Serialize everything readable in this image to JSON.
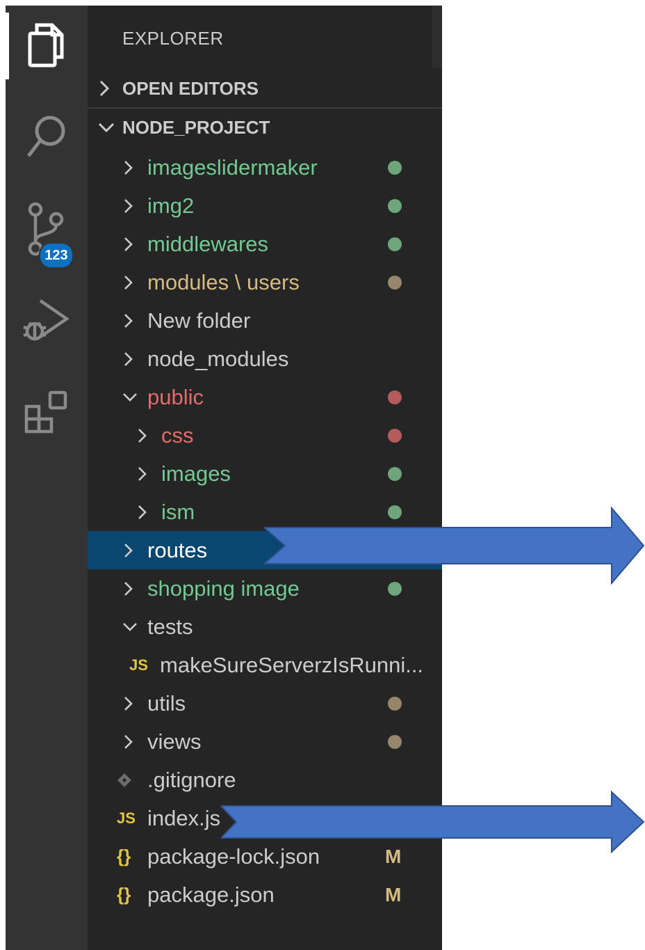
{
  "activity_bar": {
    "items": [
      {
        "icon": "files-icon",
        "active": true
      },
      {
        "icon": "search-icon",
        "active": false
      },
      {
        "icon": "source-control-icon",
        "active": false,
        "badge": "123"
      },
      {
        "icon": "run-debug-icon",
        "active": false
      },
      {
        "icon": "extensions-icon",
        "active": false
      }
    ]
  },
  "explorer": {
    "title": "EXPLORER",
    "open_editors": "OPEN EDITORS",
    "project": "NODE_PROJECT"
  },
  "tree": [
    {
      "label": "imageslidermaker",
      "kind": "folder",
      "expanded": false,
      "color": "#73c991",
      "status": "dot-green"
    },
    {
      "label": "img2",
      "kind": "folder",
      "expanded": false,
      "color": "#73c991",
      "status": "dot-green"
    },
    {
      "label": "middlewares",
      "kind": "folder",
      "expanded": false,
      "color": "#73c991",
      "status": "dot-green"
    },
    {
      "label": "modules \\ users",
      "kind": "folder",
      "expanded": false,
      "color": "#d7ba7d",
      "status": "dot-tan"
    },
    {
      "label": "New folder",
      "kind": "folder",
      "expanded": false,
      "color": "#cccccc"
    },
    {
      "label": "node_modules",
      "kind": "folder",
      "expanded": false,
      "color": "#cccccc"
    },
    {
      "label": "public",
      "kind": "folder",
      "expanded": true,
      "color": "#e06c6c",
      "status": "dot-red"
    },
    {
      "label": "css",
      "kind": "folder",
      "expanded": false,
      "color": "#e06c6c",
      "status": "dot-red"
    },
    {
      "label": "images",
      "kind": "folder",
      "expanded": false,
      "color": "#73c991",
      "status": "dot-green"
    },
    {
      "label": "ism",
      "kind": "folder",
      "expanded": false,
      "color": "#73c991",
      "status": "dot-green"
    },
    {
      "label": "routes",
      "kind": "folder",
      "expanded": false,
      "color": "#ffffff",
      "selected": true
    },
    {
      "label": "shopping image",
      "kind": "folder",
      "expanded": false,
      "color": "#73c991",
      "status": "dot-green"
    },
    {
      "label": "tests",
      "kind": "folder",
      "expanded": true,
      "color": "#cccccc"
    },
    {
      "label": "makeSureServerzIsRunni...",
      "kind": "file",
      "icon": "JS",
      "color": "#cccccc"
    },
    {
      "label": "utils",
      "kind": "folder",
      "expanded": false,
      "color": "#cccccc",
      "status": "dot-tan"
    },
    {
      "label": "views",
      "kind": "folder",
      "expanded": false,
      "color": "#cccccc",
      "status": "dot-tan"
    },
    {
      "label": ".gitignore",
      "kind": "file",
      "icon": "git-icon",
      "color": "#cccccc"
    },
    {
      "label": "index.js",
      "kind": "file",
      "icon": "JS",
      "color": "#cccccc"
    },
    {
      "label": "package-lock.json",
      "kind": "file",
      "icon": "{}",
      "color": "#cccccc",
      "status": "M"
    },
    {
      "label": "package.json",
      "kind": "file",
      "icon": "{}",
      "color": "#cccccc",
      "status": "M"
    }
  ],
  "colors": {
    "accent_arrow": "#4472c4",
    "selection": "#094771",
    "green": "#73c991",
    "red": "#e06c6c",
    "tan": "#d7ba7d"
  }
}
